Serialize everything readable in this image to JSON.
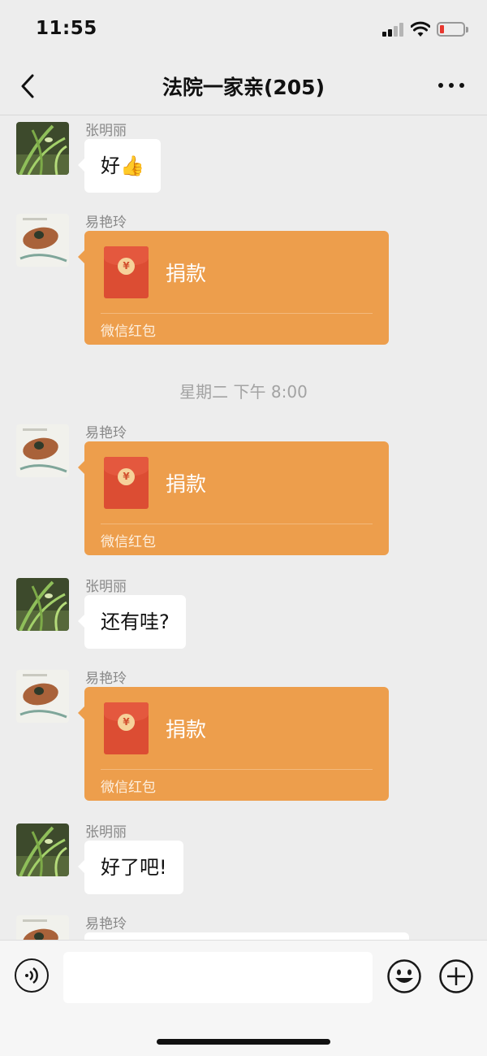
{
  "status_bar": {
    "time": "11:55",
    "signal_icon": "cellular-signal-icon",
    "wifi_icon": "wifi-icon",
    "battery_icon": "battery-low-icon",
    "battery_color": "#e8372f"
  },
  "nav": {
    "back_icon": "chevron-left-icon",
    "title": "法院一家亲(205)",
    "more_icon": "more-dots-icon"
  },
  "chat": {
    "messages": [
      {
        "type": "text",
        "sender": "张明丽",
        "text": "好",
        "emoji": "👍",
        "avatar": "orchid-avatar"
      },
      {
        "type": "red_packet",
        "sender": "易艳玲",
        "title": "捐款",
        "label": "微信红包",
        "avatar": "leaf-plate-avatar"
      },
      {
        "type": "timestamp",
        "text": "星期二 下午 8:00"
      },
      {
        "type": "red_packet",
        "sender": "易艳玲",
        "title": "捐款",
        "label": "微信红包",
        "avatar": "leaf-plate-avatar"
      },
      {
        "type": "text",
        "sender": "张明丽",
        "text": "还有哇?",
        "avatar": "orchid-avatar"
      },
      {
        "type": "red_packet",
        "sender": "易艳玲",
        "title": "捐款",
        "label": "微信红包",
        "avatar": "leaf-plate-avatar"
      },
      {
        "type": "text",
        "sender": "张明丽",
        "text": "好了吧!",
        "avatar": "orchid-avatar"
      },
      {
        "type": "partial",
        "sender": "易艳玲",
        "avatar": "leaf-plate-avatar"
      }
    ]
  },
  "input_bar": {
    "voice_icon": "voice-icon",
    "input_value": "",
    "emoji_icon": "emoji-icon",
    "plus_icon": "plus-circle-icon"
  },
  "colors": {
    "background": "#ededed",
    "red_packet": "#ed9e4c",
    "envelope": "#dc4d33"
  }
}
